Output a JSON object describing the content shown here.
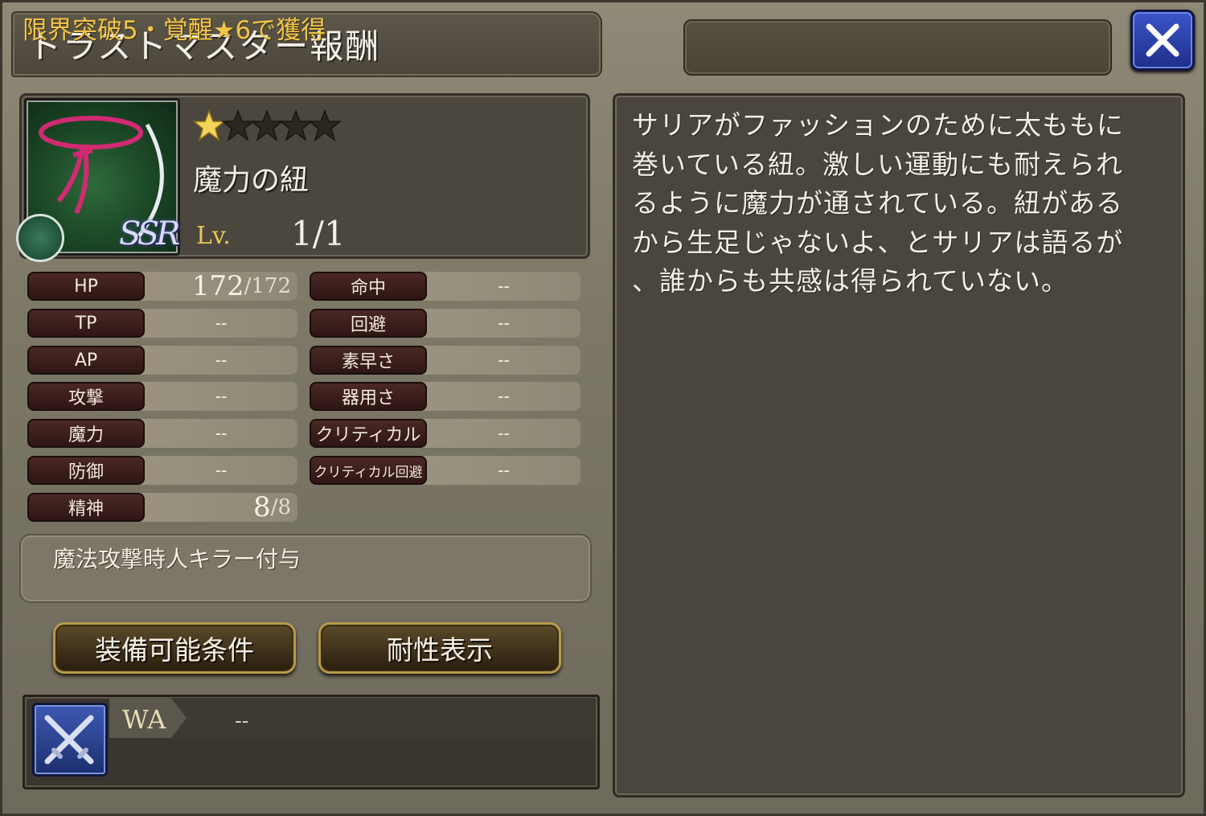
{
  "header": {
    "title": "トラストマスター報酬",
    "unlock_condition": "限界突破5・覚醒★6で獲得",
    "close_icon": "close-icon"
  },
  "item": {
    "rarity_label": "SSR",
    "stars_filled": 1,
    "stars_total": 5,
    "name": "魔力の紐",
    "level_label": "Lv.",
    "level_value": "1/1"
  },
  "stats": {
    "left": [
      {
        "label": "HP",
        "value_main": "172",
        "value_max": "/172"
      },
      {
        "label": "TP",
        "value": "--"
      },
      {
        "label": "AP",
        "value": "--"
      },
      {
        "label": "攻撃",
        "value": "--"
      },
      {
        "label": "魔力",
        "value": "--"
      },
      {
        "label": "防御",
        "value": "--"
      },
      {
        "label": "精神",
        "value_main": "8",
        "value_max": "/8"
      }
    ],
    "right": [
      {
        "label": "命中",
        "value": "--"
      },
      {
        "label": "回避",
        "value": "--"
      },
      {
        "label": "素早さ",
        "value": "--"
      },
      {
        "label": "器用さ",
        "value": "--"
      },
      {
        "label": "クリティカル",
        "value": "--"
      },
      {
        "label": "クリティカル回避",
        "value": "--"
      }
    ]
  },
  "effect": "魔法攻撃時人キラー付与",
  "buttons": {
    "equip_conditions": "装備可能条件",
    "resistance": "耐性表示"
  },
  "wa": {
    "label": "WA",
    "value": "--",
    "icon": "crossed-swords-icon"
  },
  "description": "サリアがファッションのために太ももに\n巻いている紐。激しい運動にも耐えられ\nるように魔力が通されている。紐がある\nから生足じゃないよ、とサリアは語るが\n、誰からも共感は得られていない。",
  "colors": {
    "unlock_text": "#f0c44a",
    "level_label": "#e7c658",
    "close_button": "#2b43b0",
    "stat_label_bg": "#3a1e1b"
  }
}
